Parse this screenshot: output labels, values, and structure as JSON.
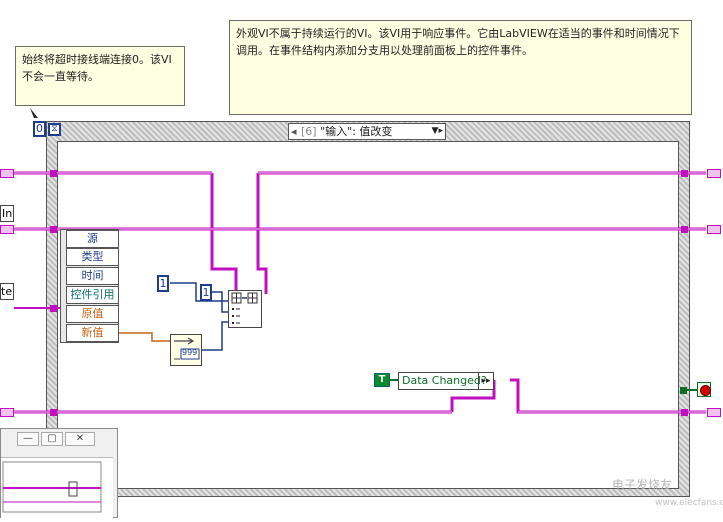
{
  "comments": {
    "timeout_note": "始终将超时接线端连接0。该VI不会一直等待。",
    "vi_note": "外观VI不属于持续运行的VI。该VI用于响应事件。它由LabVIEW在适当的事件和时间情况下调用。在事件结构内添加分支用以处理前面板上的控件事件。"
  },
  "event_structure": {
    "timeout_value": "0",
    "case_index": "[6]",
    "case_label": "\"输入\": 值改变"
  },
  "event_data_node": {
    "items": [
      "源",
      "类型",
      "时间",
      "控件引用",
      "原值",
      "新值"
    ]
  },
  "constants": {
    "c1": "1",
    "c2": "1",
    "bool_true": "T",
    "numeric_display": "999"
  },
  "unbundle": {
    "label": "Data Changed?"
  },
  "left_terminals": {
    "in_label": "In",
    "te_label": "te"
  },
  "colors": {
    "wire_pink": "#c20fbf",
    "wire_orange": "#c8641a",
    "wire_blue": "#1f3d8f",
    "wire_green": "#0c6e28",
    "comment_bg": "#ffffe1"
  },
  "watermark": {
    "text": "电子发烧友",
    "url": "www.elecfans.com"
  }
}
